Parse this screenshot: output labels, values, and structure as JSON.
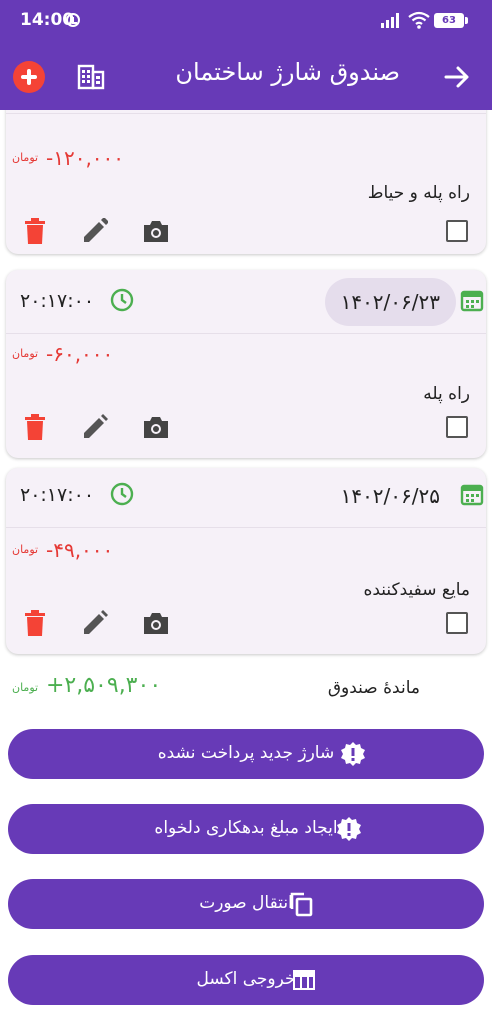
{
  "status_bar": {
    "time": "14:00",
    "battery": "63"
  },
  "app_bar": {
    "title": "صندوق شارژ ساختمان"
  },
  "cards": [
    {
      "date": "",
      "time": "",
      "amount": "-۱۲۰,۰۰۰",
      "unit": "تومان",
      "description": "راه پله و حیاط"
    },
    {
      "date": "۱۴۰۲/۰۶/۲۳",
      "time": "۲۰:۱۷:۰۰",
      "amount": "-۶۰,۰۰۰",
      "unit": "تومان",
      "description": "راه پله"
    },
    {
      "date": "۱۴۰۲/۰۶/۲۵",
      "time": "۲۰:۱۷:۰۰",
      "amount": "-۴۹,۰۰۰",
      "unit": "تومان",
      "description": "مایع سفیدکننده"
    }
  ],
  "balance": {
    "label": "ماندهٔ صندوق",
    "amount": "+۲,۵۰۹,۳۰۰",
    "unit": "تومان"
  },
  "actions": [
    {
      "label": "شارژ جدید پرداخت نشده",
      "icon": "alert-badge-icon"
    },
    {
      "label": "ایجاد مبلغ بدهکاری دلخواه",
      "icon": "alert-badge-icon"
    },
    {
      "label": "انتقال صورت",
      "icon": "copy-icon"
    },
    {
      "label": "خروجی اکسل",
      "icon": "table-icon"
    }
  ],
  "colors": {
    "primary": "#673ab7",
    "danger": "#e53935",
    "success": "#4caf50",
    "card_bg": "#f6f1f8"
  }
}
